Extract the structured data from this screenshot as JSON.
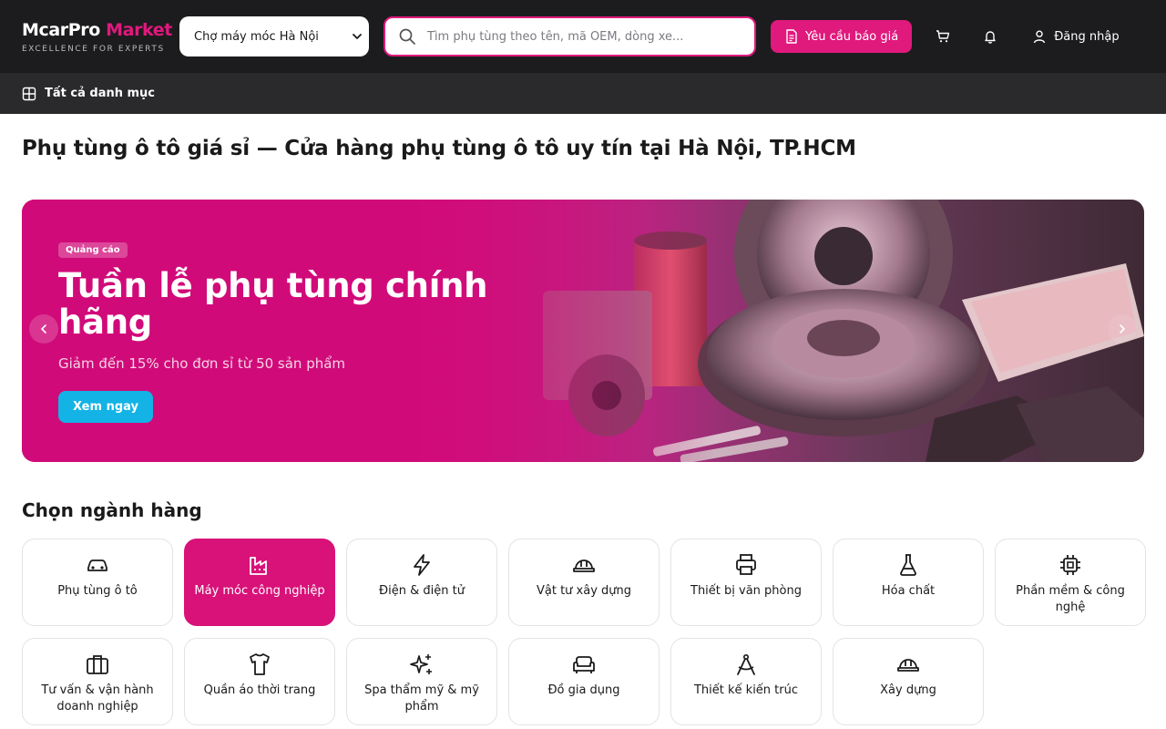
{
  "header": {
    "logo_main": "McarPro",
    "logo_accent": "Market",
    "logo_tagline": "EXCELLENCE FOR EXPERTS",
    "market_selected": "Chợ máy móc Hà Nội",
    "search_placeholder": "Tìm phụ tùng theo tên, mã OEM, dòng xe...",
    "quote_button": "Yêu cầu báo giá",
    "login": "Đăng nhập"
  },
  "catbar": {
    "label": "Tất cả danh mục"
  },
  "page": {
    "title": "Phụ tùng ô tô giá sỉ — Cửa hàng phụ tùng ô tô uy tín tại Hà Nội, TP.HCM"
  },
  "hero": {
    "badge": "Quảng cáo",
    "title": "Tuần lễ phụ tùng chính hãng",
    "subtitle": "Giảm đến 15% cho đơn sỉ từ 50 sản phẩm",
    "cta": "Xem ngay"
  },
  "industries": {
    "title": "Chọn ngành hàng",
    "items": [
      {
        "label": "Phụ tùng ô tô",
        "icon": "car-icon"
      },
      {
        "label": "Máy móc công nghiệp",
        "icon": "factory-icon"
      },
      {
        "label": "Điện & điện tử",
        "icon": "lightning-icon"
      },
      {
        "label": "Vật tư xây dựng",
        "icon": "hardhat-icon"
      },
      {
        "label": "Thiết bị văn phòng",
        "icon": "printer-icon"
      },
      {
        "label": "Hóa chất",
        "icon": "flask-icon"
      },
      {
        "label": "Phần mềm & công nghệ",
        "icon": "chip-icon"
      },
      {
        "label": "Tư vấn & vận hành doanh nghiệp",
        "icon": "briefcase-icon"
      },
      {
        "label": "Quần áo thời trang",
        "icon": "shirt-icon"
      },
      {
        "label": "Spa thẩm mỹ & mỹ phẩm",
        "icon": "sparkles-icon"
      },
      {
        "label": "Đồ gia dụng",
        "icon": "sofa-icon"
      },
      {
        "label": "Thiết kế kiến trúc",
        "icon": "compass-icon"
      },
      {
        "label": "Xây dựng",
        "icon": "hardhat-icon"
      }
    ]
  },
  "colors": {
    "accent": "#e0197d",
    "header_bg": "#1c1c1e",
    "catbar_bg": "#2a2a2d",
    "cta": "#13b3e6"
  }
}
